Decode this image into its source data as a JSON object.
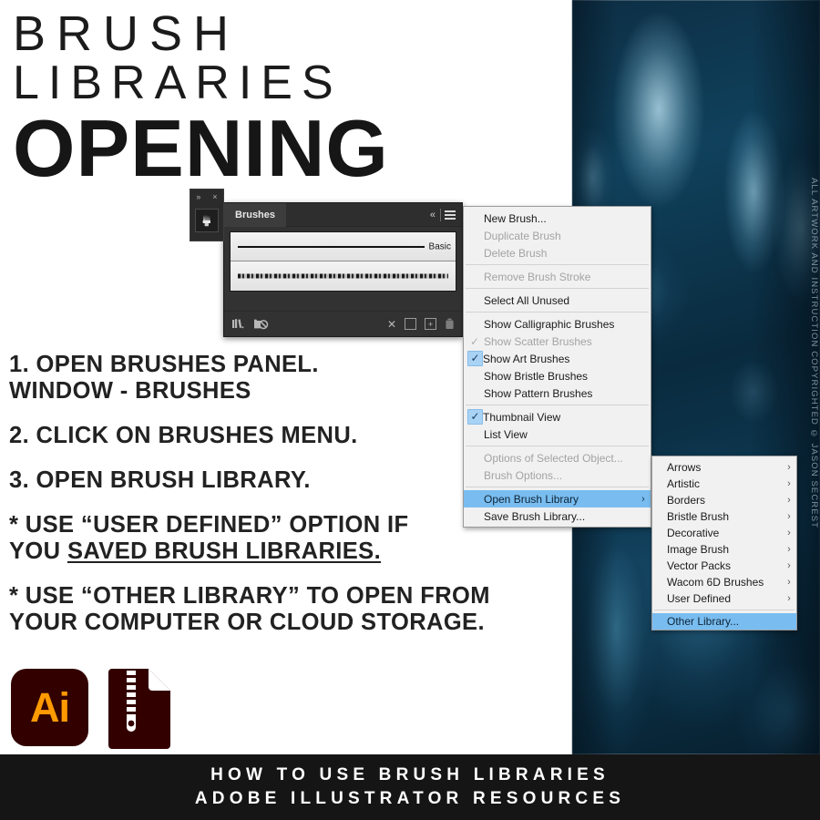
{
  "headline": {
    "line1": "BRUSH",
    "line2": "LIBRARIES",
    "line3": "OPENING"
  },
  "instructions": [
    {
      "l1": "1. OPEN BRUSHES PANEL.",
      "l2": "WINDOW - BRUSHES"
    },
    {
      "l1": "2. CLICK ON BRUSHES MENU."
    },
    {
      "l1": "3. OPEN BRUSH LIBRARY."
    },
    {
      "l1": "* USE “USER DEFINED” OPTION IF",
      "l2pre": "YOU ",
      "l2under": "SAVED BRUSH LIBRARIES."
    },
    {
      "l1": "* USE “OTHER LIBRARY” TO OPEN FROM",
      "l2": "YOUR COMPUTER OR CLOUD STORAGE."
    }
  ],
  "panel": {
    "dock_tab": {
      "expand": "»",
      "close": "×",
      "brush_icon": "🖌"
    },
    "title": "Brushes",
    "collapse": "«",
    "brushes": [
      {
        "name": "Basic",
        "style": "solid"
      },
      {
        "name": "",
        "style": "textured"
      }
    ],
    "footer_icons": {
      "brush_libraries": "ⓘ",
      "cc_libraries": "◑",
      "remove_stroke": "✕",
      "options": "▤",
      "new_brush": "+",
      "delete_brush": "🗑"
    }
  },
  "context_menu": {
    "items": [
      {
        "label": "New Brush...",
        "state": "enabled"
      },
      {
        "label": "Duplicate Brush",
        "state": "disabled"
      },
      {
        "label": "Delete Brush",
        "state": "disabled"
      },
      {
        "sep": true
      },
      {
        "label": "Remove Brush Stroke",
        "state": "disabled"
      },
      {
        "sep": true
      },
      {
        "label": "Select All Unused",
        "state": "enabled"
      },
      {
        "sep": true
      },
      {
        "label": "Show Calligraphic Brushes",
        "state": "enabled"
      },
      {
        "label": "Show Scatter Brushes",
        "state": "disabled",
        "check": "dim"
      },
      {
        "label": "Show Art Brushes",
        "state": "enabled",
        "check": "on"
      },
      {
        "label": "Show Bristle Brushes",
        "state": "enabled"
      },
      {
        "label": "Show Pattern Brushes",
        "state": "enabled"
      },
      {
        "sep": true
      },
      {
        "label": "Thumbnail View",
        "state": "enabled",
        "check": "on"
      },
      {
        "label": "List View",
        "state": "enabled"
      },
      {
        "sep": true
      },
      {
        "label": "Options of Selected Object...",
        "state": "disabled"
      },
      {
        "label": "Brush Options...",
        "state": "disabled"
      },
      {
        "sep": true
      },
      {
        "label": "Open Brush Library",
        "state": "selected",
        "arrow": "›"
      },
      {
        "label": "Save Brush Library...",
        "state": "enabled"
      }
    ]
  },
  "sub_menu": {
    "items": [
      {
        "label": "Arrows",
        "arrow": "›"
      },
      {
        "label": "Artistic",
        "arrow": "›"
      },
      {
        "label": "Borders",
        "arrow": "›"
      },
      {
        "label": "Bristle Brush",
        "arrow": "›"
      },
      {
        "label": "Decorative",
        "arrow": "›"
      },
      {
        "label": "Image Brush",
        "arrow": "›"
      },
      {
        "label": "Vector Packs",
        "arrow": "›"
      },
      {
        "label": "Wacom 6D Brushes",
        "arrow": "›"
      },
      {
        "label": "User Defined",
        "arrow": "›"
      },
      {
        "sep": true
      },
      {
        "label": "Other Library...",
        "state": "selected"
      }
    ]
  },
  "app_icons": {
    "illustrator_label": "Ai",
    "zip_label": "zip-file-icon"
  },
  "footer": {
    "line1": "HOW TO USE BRUSH LIBRARIES",
    "line2": "ADOBE ILLUSTRATOR RESOURCES"
  },
  "copyright": "ALL ARTWORK AND INSTRUCTION COPYRIGHTED © JASON SECREST",
  "colors": {
    "accent_blue": "#79bdf0",
    "menu_bg": "#f1f1f1",
    "panel_bg": "#323232",
    "footer_bg": "#151515",
    "ai_bg": "#330000",
    "ai_fg": "#ff9a00",
    "photo_tint": "#0d2f45"
  }
}
